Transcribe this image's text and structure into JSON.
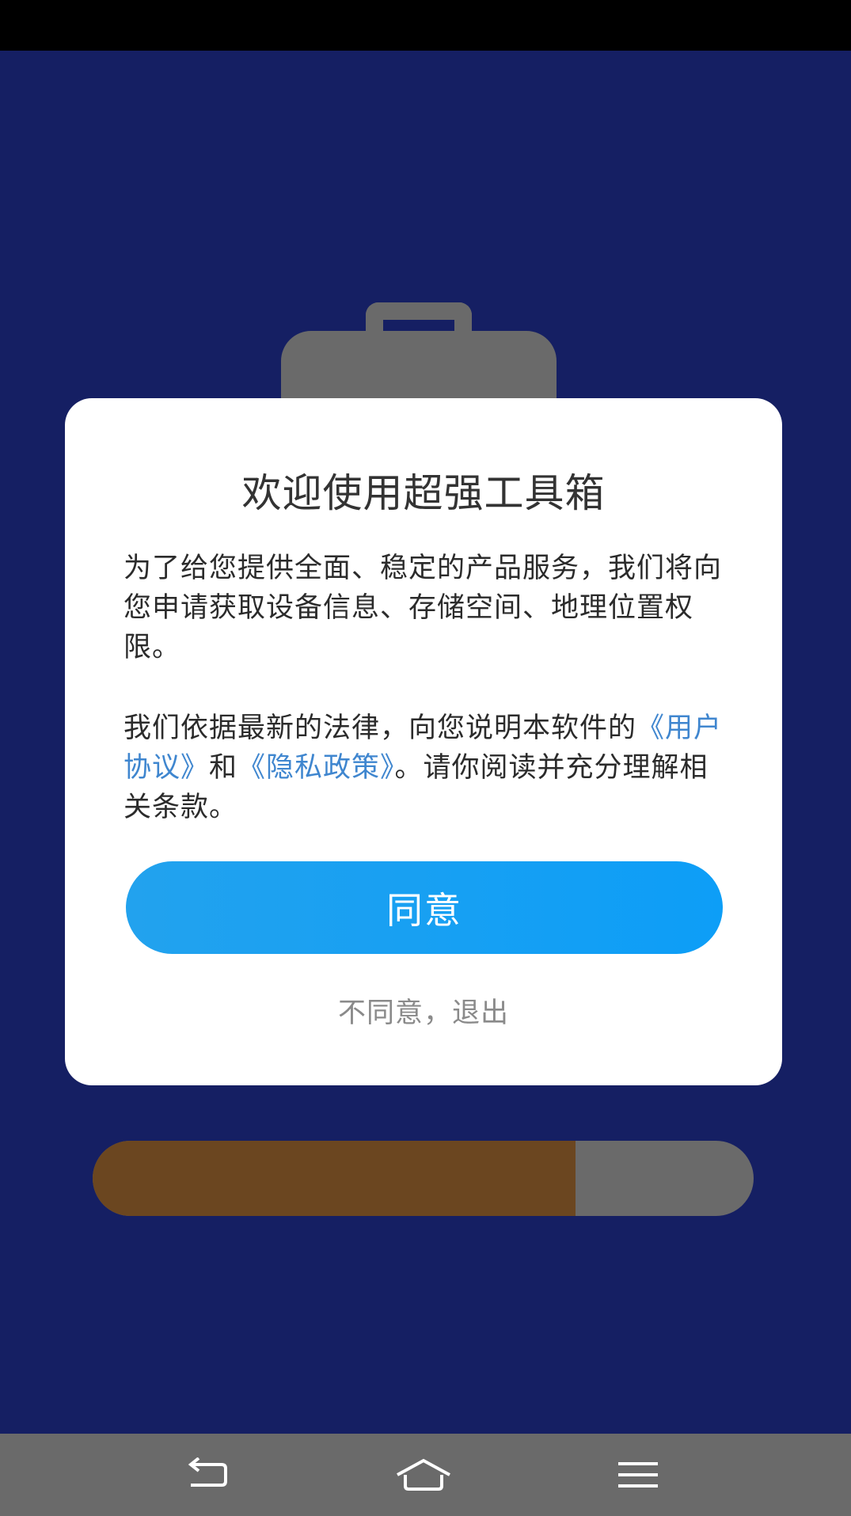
{
  "app": {
    "background_color": "#151f63",
    "accent_color": "#0d9ef7",
    "link_color": "#3f86cf"
  },
  "dialog": {
    "title": "欢迎使用超强工具箱",
    "paragraph1": "为了给您提供全面、稳定的产品服务，我们将向您申请获取设备信息、存储空间、地理位置权限。",
    "paragraph2_intro": "我们依据最新的法律，向您说明本软件的",
    "user_agreement_link": "《用户协议》",
    "conjunction": "和",
    "privacy_policy_link": "《隐私政策》",
    "paragraph2_outro": "。请你阅读并充分理解相关条款。",
    "agree_label": "同意",
    "disagree_label": "不同意，退出"
  },
  "background": {
    "illustration_icon": "briefcase-icon",
    "progress": {
      "fraction": 0.73,
      "fill_color": "#6b4620",
      "track_color": "#6a6a6a"
    }
  },
  "navigation": {
    "back_icon": "back-icon",
    "home_icon": "home-icon",
    "menu_icon": "menu-icon"
  }
}
